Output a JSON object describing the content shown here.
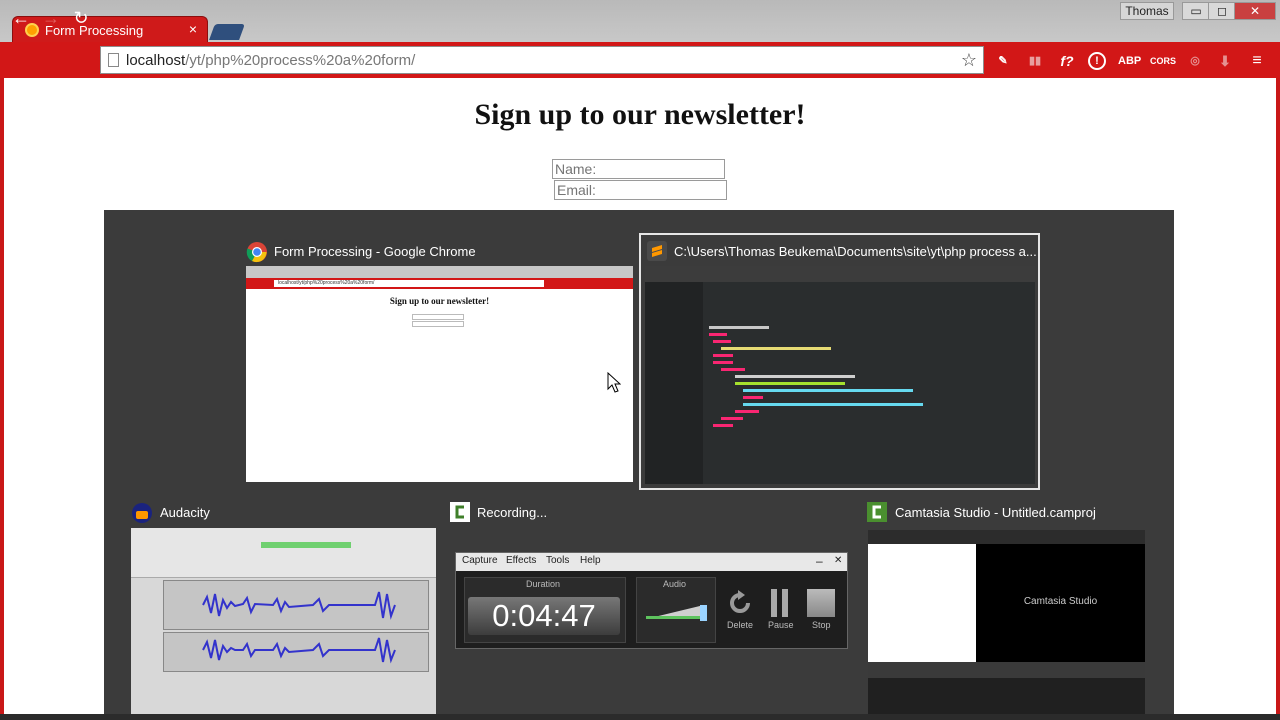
{
  "window": {
    "user": "Thomas",
    "minimize": "▭",
    "restore": "◻",
    "close": "✕"
  },
  "tab": {
    "title": "Form Processing",
    "close": "×"
  },
  "omnibox": {
    "host": "localhost",
    "path": "/yt/php%20process%20a%20form/"
  },
  "extensions": [
    "✎",
    "▮▮",
    "f?",
    "!",
    "ABP",
    "CORS",
    "◎",
    "⬇",
    "≡"
  ],
  "page": {
    "title": "Sign up to our newsletter!",
    "name_placeholder": "Name:",
    "email_placeholder": "Email:"
  },
  "switcher": {
    "windows": [
      {
        "label": "Form Processing - Google Chrome",
        "icon": "chrome-icon"
      },
      {
        "label": "C:\\Users\\Thomas Beukema\\Documents\\site\\yt\\php process a...",
        "icon": "sublime-icon"
      },
      {
        "label": "Audacity",
        "icon": "audacity-icon"
      },
      {
        "label": "Recording...",
        "icon": "camtasia-icon"
      },
      {
        "label": "Camtasia Studio - Untitled.camproj",
        "icon": "camtasia-icon"
      }
    ],
    "chrome_thumb": {
      "title": "Sign up to our newsletter!",
      "url": "localhost/yt/php%20process%20a%20form/"
    },
    "recorder": {
      "menu": [
        "Capture",
        "Effects",
        "Tools",
        "Help"
      ],
      "duration_label": "Duration",
      "duration": "0:04:47",
      "audio_label": "Audio",
      "buttons": [
        "Delete",
        "Pause",
        "Stop"
      ],
      "min": "–",
      "close": "✕"
    },
    "camtasia_thumb": {
      "splash": "Camtasia Studio"
    }
  }
}
